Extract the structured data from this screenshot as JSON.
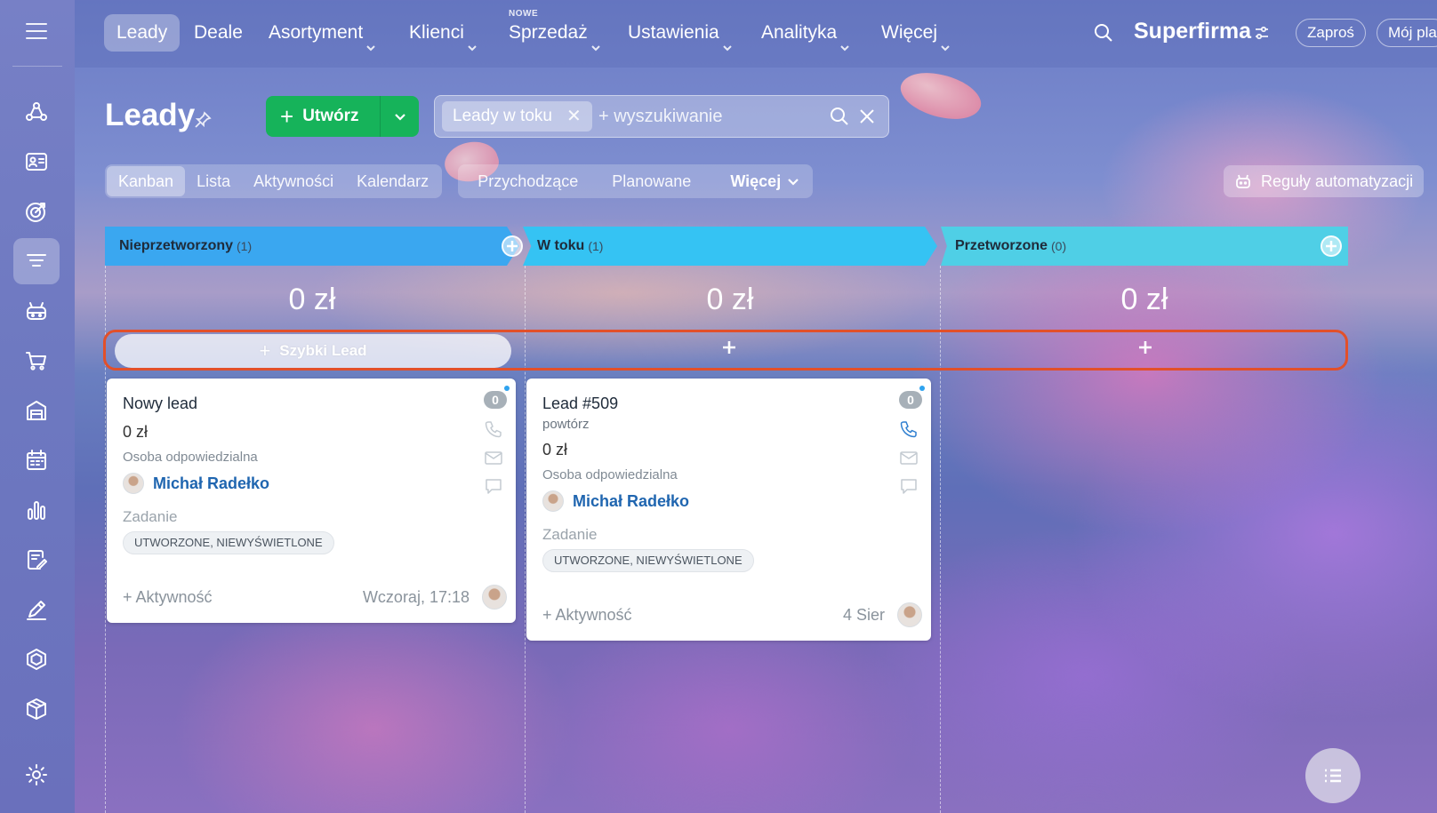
{
  "nav": {
    "items": [
      {
        "label": "Leady",
        "active": true,
        "has_menu": false
      },
      {
        "label": "Deale",
        "active": false,
        "has_menu": false
      },
      {
        "label": "Asortyment",
        "active": false,
        "has_menu": true
      },
      {
        "label": "Klienci",
        "active": false,
        "has_menu": true
      },
      {
        "label": "Sprzedaż",
        "active": false,
        "has_menu": true
      },
      {
        "label": "Ustawienia",
        "active": false,
        "has_menu": true
      },
      {
        "label": "Analityka",
        "active": false,
        "has_menu": true
      },
      {
        "label": "Więcej",
        "active": false,
        "has_menu": true
      }
    ],
    "new_badge": "NOWE",
    "brand": "Superfirma",
    "invite_label": "Zaproś",
    "plan_label": "Mój pla"
  },
  "sidebar": {
    "icons": [
      "menu-icon",
      "contacts-network-icon",
      "contact-card-icon",
      "target-icon",
      "funnel-icon",
      "robot-icon",
      "cart-icon",
      "warehouse-icon",
      "calendar-grid-icon",
      "analytics-bars-icon",
      "document-sign-icon",
      "pen-icon",
      "hexagon-icon",
      "cube-icon",
      "gear-icon"
    ],
    "active": "funnel-icon"
  },
  "page": {
    "title": "Leady",
    "create_label": "Utwórz",
    "filter_chip": "Leady w toku",
    "search_placeholder": "+ wyszukiwanie",
    "views": [
      "Kanban",
      "Lista",
      "Aktywności",
      "Kalendarz"
    ],
    "active_view": "Kanban",
    "sub_filters": [
      "Przychodzące",
      "Planowane"
    ],
    "more_label": "Więcej",
    "automation_label": "Reguły automatyzacji"
  },
  "columns": [
    {
      "title": "Nieprzetworzony",
      "count": "(1)",
      "sum": "0 zł",
      "color": "#3aa7f0"
    },
    {
      "title": "W toku",
      "count": "(1)",
      "sum": "0 zł",
      "color": "#35c3f3"
    },
    {
      "title": "Przetworzone",
      "count": "(0)",
      "sum": "0 zł",
      "color": "#4fcfe6"
    }
  ],
  "quick_lead_label": "Szybki Lead",
  "cards": [
    {
      "title": "Nowy lead",
      "subtitle": "",
      "amount": "0 zł",
      "responsible_label": "Osoba odpowiedzialna",
      "person": "Michał Radełko",
      "task_label": "Zadanie",
      "task_status": "UTWORZONE, NIEWYŚWIETLONE",
      "add_activity": "+ Aktywność",
      "date": "Wczoraj, 17:18",
      "counter": "0"
    },
    {
      "title": "Lead #509",
      "subtitle": "powtórz",
      "amount": "0 zł",
      "responsible_label": "Osoba odpowiedzialna",
      "person": "Michał Radełko",
      "task_label": "Zadanie",
      "task_status": "UTWORZONE, NIEWYŚWIETLONE",
      "add_activity": "+ Aktywność",
      "date": "4 Sier",
      "counter": "0"
    }
  ]
}
